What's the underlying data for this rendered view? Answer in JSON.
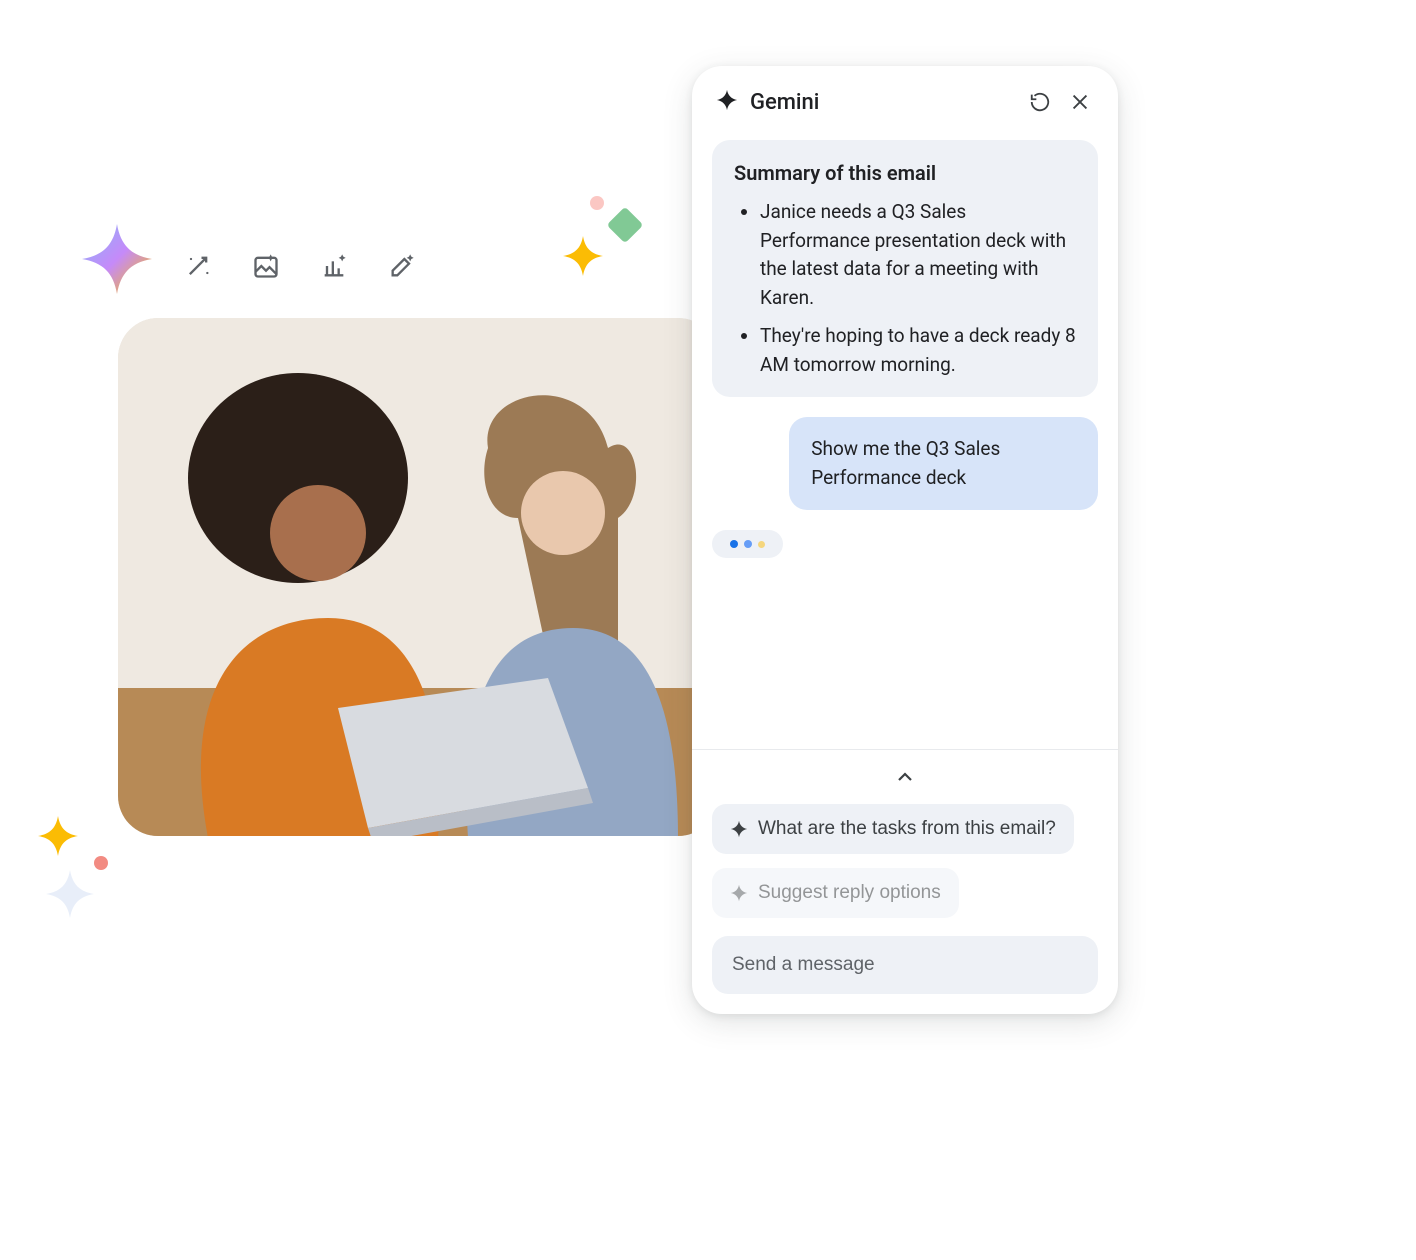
{
  "gemini": {
    "title": "Gemini",
    "summary": {
      "heading": "Summary of this email",
      "bullets": [
        "Janice needs a Q3 Sales Performance presentation deck with the latest data for a meeting with Karen.",
        "They're hoping to have a deck ready 8 AM tomorrow morning."
      ]
    },
    "userMessage": "Show me the Q3 Sales Performance deck",
    "suggestions": [
      "What are the tasks from this email?",
      "Suggest reply options"
    ],
    "input": {
      "placeholder": "Send a message"
    }
  }
}
